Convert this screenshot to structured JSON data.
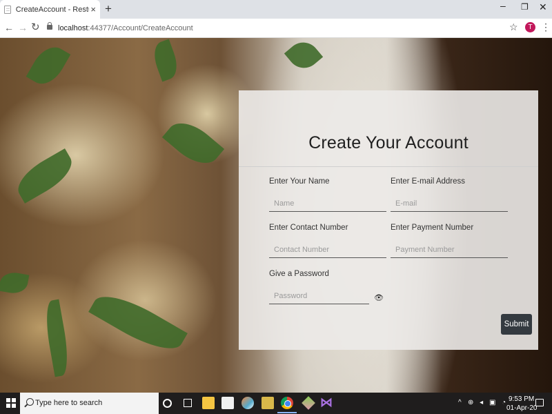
{
  "browser": {
    "tab_title": "CreateAccount - Resturant Mana",
    "tab_close": "×",
    "new_tab": "+",
    "url_host": "localhost",
    "url_rest": ":44377/Account/CreateAccount",
    "profile_initial": "T",
    "window_controls": {
      "minimize": "–",
      "maximize": "❐",
      "close": "✕"
    },
    "icons": [
      "back-icon",
      "forward-icon",
      "reload-icon",
      "lock-icon",
      "star-icon",
      "menu-icon"
    ]
  },
  "form": {
    "title": "Create Your Account",
    "fields": {
      "name": {
        "label": "Enter Your Name",
        "placeholder": "Name"
      },
      "email": {
        "label": "Enter E-mail Address",
        "placeholder": "E-mail"
      },
      "contact": {
        "label": "Enter Contact Number",
        "placeholder": "Contact Number"
      },
      "payment": {
        "label": "Enter Payment Number",
        "placeholder": "Payment Number"
      },
      "password": {
        "label": "Give a Password",
        "placeholder": "Password"
      }
    },
    "submit_label": "Submit",
    "submit_color": "#343a40"
  },
  "taskbar": {
    "search_text": "Type here to search",
    "time": "9:53 PM",
    "date": "01-Apr-20",
    "tray_chevron": "^",
    "tray_icons": "⊕ ◂ ▣ ◔"
  }
}
